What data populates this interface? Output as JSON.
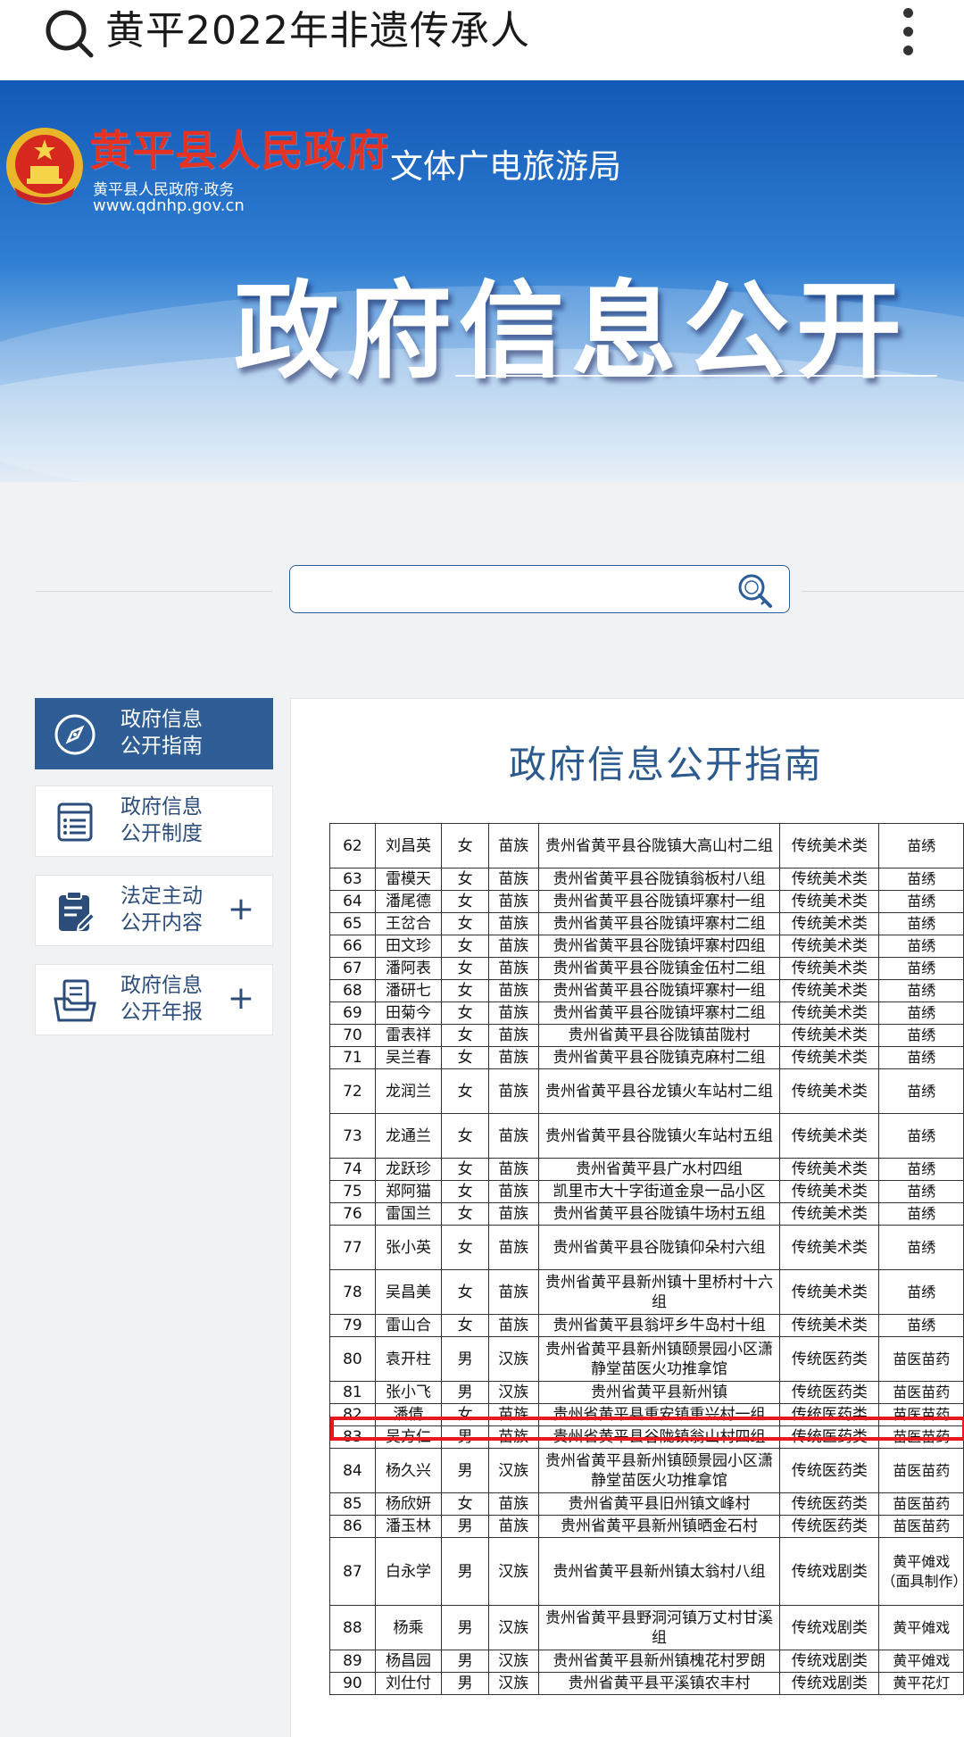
{
  "search_bar": {
    "query": "黄平2022年非遗传承人"
  },
  "banner": {
    "gov_name": "黄平县人民政府",
    "gov_sub": "黄平县人民政府·政务",
    "gov_url": "www.qdnhp.gov.cn",
    "bureau": "文体广电旅游局",
    "title": "政府信息公开"
  },
  "site_search": {
    "placeholder": ""
  },
  "sidebar": {
    "items": [
      {
        "line1": "政府信息",
        "line2": "公开指南",
        "icon": "compass-icon",
        "active": true,
        "expandable": false
      },
      {
        "line1": "政府信息",
        "line2": "公开制度",
        "icon": "document-list-icon",
        "active": false,
        "expandable": false
      },
      {
        "line1": "法定主动",
        "line2": "公开内容",
        "icon": "clipboard-edit-icon",
        "active": false,
        "expandable": true
      },
      {
        "line1": "政府信息",
        "line2": "公开年报",
        "icon": "folder-document-icon",
        "active": false,
        "expandable": true
      }
    ],
    "plus": "+"
  },
  "panel": {
    "title": "政府信息公开指南"
  },
  "table": {
    "rows": [
      {
        "no": "62",
        "name": "刘昌英",
        "sex": "女",
        "eth": "苗族",
        "addr": "贵州省黄平县谷陇镇大高山村二组",
        "cat": "传统美术类",
        "proj": "苗绣"
      },
      {
        "no": "63",
        "name": "雷模天",
        "sex": "女",
        "eth": "苗族",
        "addr": "贵州省黄平县谷陇镇翁板村八组",
        "cat": "传统美术类",
        "proj": "苗绣"
      },
      {
        "no": "64",
        "name": "潘尾德",
        "sex": "女",
        "eth": "苗族",
        "addr": "贵州省黄平县谷陇镇坪寨村一组",
        "cat": "传统美术类",
        "proj": "苗绣"
      },
      {
        "no": "65",
        "name": "王岔合",
        "sex": "女",
        "eth": "苗族",
        "addr": "贵州省黄平县谷陇镇坪寨村二组",
        "cat": "传统美术类",
        "proj": "苗绣"
      },
      {
        "no": "66",
        "name": "田文珍",
        "sex": "女",
        "eth": "苗族",
        "addr": "贵州省黄平县谷陇镇坪寨村四组",
        "cat": "传统美术类",
        "proj": "苗绣"
      },
      {
        "no": "67",
        "name": "潘阿表",
        "sex": "女",
        "eth": "苗族",
        "addr": "贵州省黄平县谷陇镇金伍村二组",
        "cat": "传统美术类",
        "proj": "苗绣"
      },
      {
        "no": "68",
        "name": "潘研七",
        "sex": "女",
        "eth": "苗族",
        "addr": "贵州省黄平县谷陇镇坪寨村一组",
        "cat": "传统美术类",
        "proj": "苗绣"
      },
      {
        "no": "69",
        "name": "田菊今",
        "sex": "女",
        "eth": "苗族",
        "addr": "贵州省黄平县谷陇镇坪寨村二组",
        "cat": "传统美术类",
        "proj": "苗绣"
      },
      {
        "no": "70",
        "name": "雷表祥",
        "sex": "女",
        "eth": "苗族",
        "addr": "贵州省黄平县谷陇镇苗陇村",
        "cat": "传统美术类",
        "proj": "苗绣"
      },
      {
        "no": "71",
        "name": "吴兰春",
        "sex": "女",
        "eth": "苗族",
        "addr": "贵州省黄平县谷陇镇克麻村二组",
        "cat": "传统美术类",
        "proj": "苗绣"
      },
      {
        "no": "72",
        "name": "龙润兰",
        "sex": "女",
        "eth": "苗族",
        "addr": "贵州省黄平县谷龙镇火车站村二组",
        "cat": "传统美术类",
        "proj": "苗绣"
      },
      {
        "no": "73",
        "name": "龙通兰",
        "sex": "女",
        "eth": "苗族",
        "addr": "贵州省黄平县谷陇镇火车站村五组",
        "cat": "传统美术类",
        "proj": "苗绣"
      },
      {
        "no": "74",
        "name": "龙跃珍",
        "sex": "女",
        "eth": "苗族",
        "addr": "贵州省黄平县广水村四组",
        "cat": "传统美术类",
        "proj": "苗绣"
      },
      {
        "no": "75",
        "name": "郑阿猫",
        "sex": "女",
        "eth": "苗族",
        "addr": "凯里市大十字街道金泉一品小区",
        "cat": "传统美术类",
        "proj": "苗绣"
      },
      {
        "no": "76",
        "name": "雷国兰",
        "sex": "女",
        "eth": "苗族",
        "addr": "贵州省黄平县谷陇镇牛场村五组",
        "cat": "传统美术类",
        "proj": "苗绣"
      },
      {
        "no": "77",
        "name": "张小英",
        "sex": "女",
        "eth": "苗族",
        "addr": "贵州省黄平县谷陇镇仰朵村六组",
        "cat": "传统美术类",
        "proj": "苗绣"
      },
      {
        "no": "78",
        "name": "吴昌美",
        "sex": "女",
        "eth": "苗族",
        "addr": "贵州省黄平县新州镇十里桥村十六组",
        "cat": "传统美术类",
        "proj": "苗绣"
      },
      {
        "no": "79",
        "name": "雷山合",
        "sex": "女",
        "eth": "苗族",
        "addr": "贵州省黄平县翁坪乡牛岛村十组",
        "cat": "传统美术类",
        "proj": "苗绣"
      },
      {
        "no": "80",
        "name": "袁开柱",
        "sex": "男",
        "eth": "汉族",
        "addr": "贵州省黄平县新州镇颐景园小区潇静堂苗医火功推拿馆",
        "cat": "传统医药类",
        "proj": "苗医苗药"
      },
      {
        "no": "81",
        "name": "张小飞",
        "sex": "男",
        "eth": "汉族",
        "addr": "贵州省黄平县新州镇",
        "cat": "传统医药类",
        "proj": "苗医苗药"
      },
      {
        "no": "82",
        "name": "潘倩",
        "sex": "女",
        "eth": "苗族",
        "addr": "贵州省黄平县重安镇重兴村一组",
        "cat": "传统医药类",
        "proj": "苗医苗药"
      },
      {
        "no": "83",
        "name": "吴方仁",
        "sex": "男",
        "eth": "苗族",
        "addr": "贵州省黄平县谷陇镇翁山村四组",
        "cat": "传统医药类",
        "proj": "苗医苗药"
      },
      {
        "no": "84",
        "name": "杨久兴",
        "sex": "男",
        "eth": "汉族",
        "addr": "贵州省黄平县新州镇颐景园小区潇静堂苗医火功推拿馆",
        "cat": "传统医药类",
        "proj": "苗医苗药"
      },
      {
        "no": "85",
        "name": "杨欣妍",
        "sex": "女",
        "eth": "苗族",
        "addr": "贵州省黄平县旧州镇文峰村",
        "cat": "传统医药类",
        "proj": "苗医苗药"
      },
      {
        "no": "86",
        "name": "潘玉林",
        "sex": "男",
        "eth": "苗族",
        "addr": "贵州省黄平县新州镇晒金石村",
        "cat": "传统医药类",
        "proj": "苗医苗药"
      },
      {
        "no": "87",
        "name": "白永学",
        "sex": "男",
        "eth": "汉族",
        "addr": "贵州省黄平县新州镇太翁村八组",
        "cat": "传统戏剧类",
        "proj": "黄平傩戏（面具制作）"
      },
      {
        "no": "88",
        "name": "杨乘",
        "sex": "男",
        "eth": "汉族",
        "addr": "贵州省黄平县野洞河镇万丈村甘溪组",
        "cat": "传统戏剧类",
        "proj": "黄平傩戏"
      },
      {
        "no": "89",
        "name": "杨昌园",
        "sex": "男",
        "eth": "汉族",
        "addr": "贵州省黄平县新州镇槐花村罗朗",
        "cat": "传统戏剧类",
        "proj": "黄平傩戏"
      },
      {
        "no": "90",
        "name": "刘仕付",
        "sex": "男",
        "eth": "汉族",
        "addr": "贵州省黄平县平溪镇农丰村",
        "cat": "传统戏剧类",
        "proj": "黄平花灯"
      }
    ]
  }
}
